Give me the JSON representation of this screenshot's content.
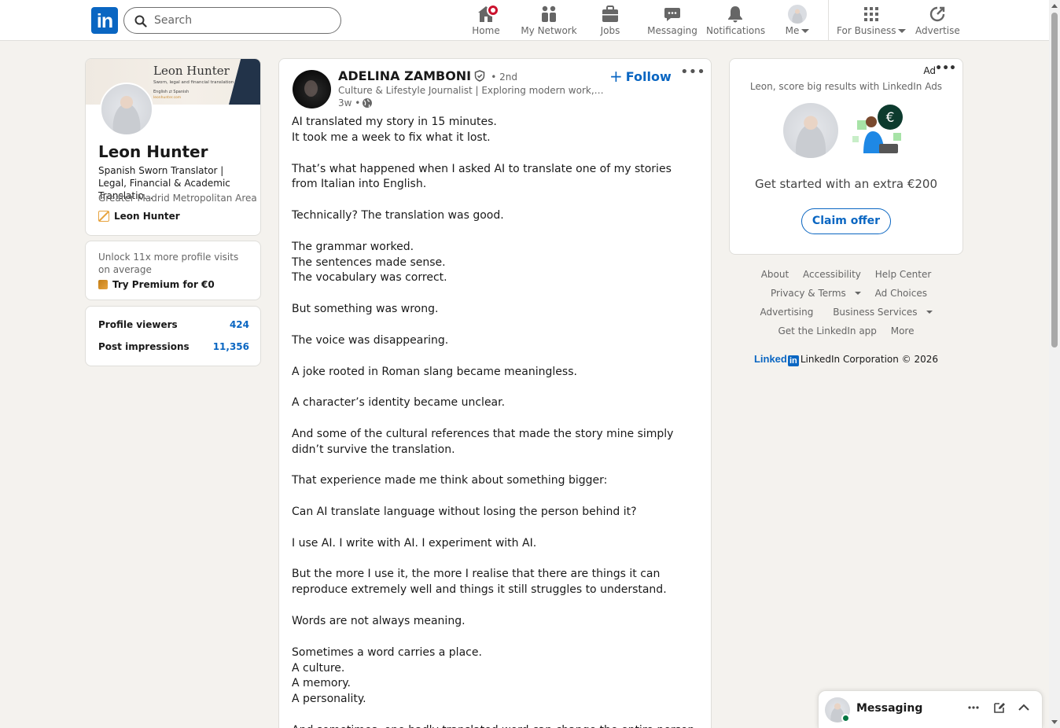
{
  "header": {
    "search_placeholder": "Search",
    "nav": [
      {
        "label": "Home",
        "icon": "home-icon"
      },
      {
        "label": "My Network",
        "icon": "network-icon"
      },
      {
        "label": "Jobs",
        "icon": "briefcase-icon"
      },
      {
        "label": "Messaging",
        "icon": "chat-icon"
      },
      {
        "label": "Notifications",
        "icon": "bell-icon"
      },
      {
        "label": "Me",
        "icon": "me-avatar"
      },
      {
        "label": "For Business",
        "icon": "grid-icon"
      },
      {
        "label": "Advertise",
        "icon": "advertise-icon"
      }
    ]
  },
  "profile": {
    "banner_name": "Leon Hunter",
    "banner_sub": "Sworn, legal and financial translation",
    "banner_sub2": "English ⇄ Spanish",
    "banner_url": "leonhunter.com",
    "name": "Leon Hunter",
    "headline": "Spanish Sworn Translator | Legal, Financial & Academic Translatio…",
    "location": "Greater Madrid Metropolitan Area",
    "link": "Leon Hunter"
  },
  "premium": {
    "text": "Unlock 11x more profile visits on average",
    "cta": "Try Premium for €0"
  },
  "stats": [
    {
      "label": "Profile viewers",
      "value": "424"
    },
    {
      "label": "Post impressions",
      "value": "11,356"
    }
  ],
  "post": {
    "author": "ADELINA ZAMBONI",
    "degree": "• 2nd",
    "headline": "Culture & Lifestyle Journalist | Exploring modern work, per...",
    "time": "3w •",
    "follow_label": "Follow",
    "menu": "•••",
    "paragraphs": [
      [
        "AI translated my story in 15 minutes.",
        "It took me a week to fix what it lost."
      ],
      [
        "That’s what happened when I asked AI to translate one of my stories from Italian into English."
      ],
      [
        "Technically? The translation was good."
      ],
      [
        "The grammar worked.",
        "The sentences made sense.",
        "The vocabulary was correct."
      ],
      [
        "But something was wrong."
      ],
      [
        "The voice was disappearing."
      ],
      [
        "A joke rooted in Roman slang became meaningless."
      ],
      [
        "A character’s identity became unclear."
      ],
      [
        "And some of the cultural references that made the story mine simply didn’t survive the translation."
      ],
      [
        "That experience made me think about something bigger:"
      ],
      [
        "Can AI translate language without losing the person behind it?"
      ],
      [
        "I use AI. I write with AI. I experiment with AI."
      ],
      [
        "But the more I use it, the more I realise that there are things it can reproduce extremely well and things it still struggles to understand."
      ],
      [
        "Words are not always meaning."
      ],
      [
        "Sometimes a word carries a place.",
        "A culture.",
        "A memory.",
        "A personality."
      ],
      [
        "And sometimes, one badly translated word can change the entire person."
      ]
    ]
  },
  "ad": {
    "label": "Ad",
    "menu": "•••",
    "text": "Leon, score big results with LinkedIn Ads",
    "headline": "Get started with an extra €200",
    "cta": "Claim offer"
  },
  "footer": {
    "row1": [
      "About",
      "Accessibility",
      "Help Center"
    ],
    "row2": [
      "Privacy & Terms",
      "Ad Choices"
    ],
    "row3": [
      "Advertising",
      "Business Services"
    ],
    "row4": [
      "Get the LinkedIn app",
      "More"
    ],
    "brand": "Linked",
    "brand_in": "in",
    "copyright": "LinkedIn Corporation © 2026"
  },
  "messaging": {
    "title": "Messaging"
  },
  "colors": {
    "brand": "#0a66c2",
    "notification": "#cb112d",
    "online": "#057642"
  }
}
